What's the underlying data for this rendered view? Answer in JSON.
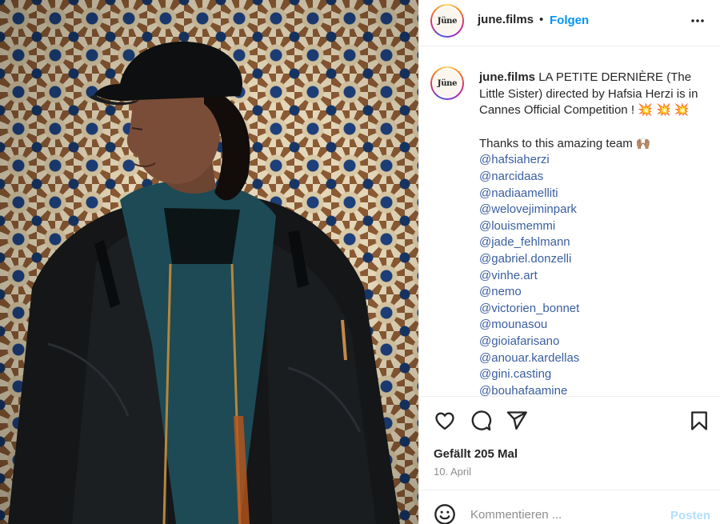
{
  "post": {
    "username": "june.films",
    "avatar_text": "Jüne",
    "follow_label": "Folgen",
    "separator": "•"
  },
  "caption": {
    "username": "june.films",
    "text": "LA PETITE DERNIÈRE (The Little Sister) directed by Hafsia Herzi is in Cannes Official Competition ! ",
    "sparkles": "💥 💥 💥",
    "thanks": "Thanks to this amazing team 🙌🏽",
    "mentions": [
      "@hafsiaherzi",
      "@narcidaas",
      "@nadiaamelliti",
      "@welovejiminpark",
      "@louismemmi",
      "@jade_fehlmann",
      "@gabriel.donzelli",
      "@vinhe.art",
      "@nemo",
      "@victorien_bonnet",
      "@mounasou",
      "@gioiafarisano",
      "@anouar.kardellas",
      "@gini.casting",
      "@bouhafaamine"
    ]
  },
  "stats": {
    "likes": "Gefällt 205 Mal",
    "date": "10. April"
  },
  "comment": {
    "placeholder": "Kommentieren ...",
    "post_label": "Posten"
  },
  "icons": {
    "more": "more-horizontal-icon",
    "like": "heart-icon",
    "comment": "comment-bubble-icon",
    "share": "paper-plane-icon",
    "save": "bookmark-icon",
    "emoji": "emoji-icon"
  },
  "colors": {
    "accent": "#0095f6",
    "mention": "#3a5fa0",
    "muted": "#8e8e8e",
    "post_disabled": "#b3dffc"
  }
}
